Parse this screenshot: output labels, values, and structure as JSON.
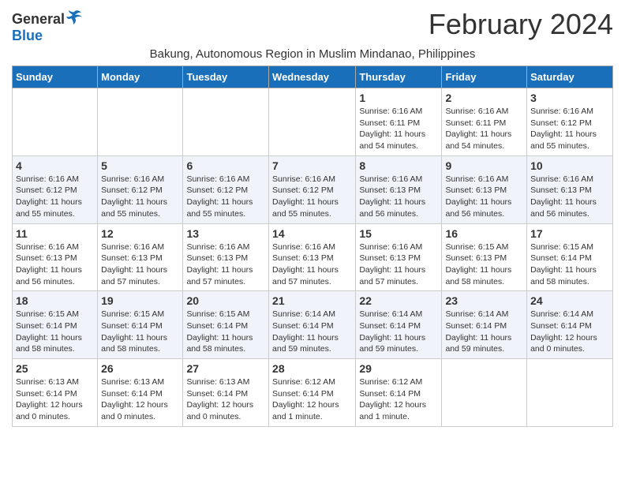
{
  "logo": {
    "general": "General",
    "blue": "Blue"
  },
  "title": "February 2024",
  "subtitle": "Bakung, Autonomous Region in Muslim Mindanao, Philippines",
  "days_of_week": [
    "Sunday",
    "Monday",
    "Tuesday",
    "Wednesday",
    "Thursday",
    "Friday",
    "Saturday"
  ],
  "weeks": [
    [
      {
        "day": "",
        "info": ""
      },
      {
        "day": "",
        "info": ""
      },
      {
        "day": "",
        "info": ""
      },
      {
        "day": "",
        "info": ""
      },
      {
        "day": "1",
        "info": "Sunrise: 6:16 AM\nSunset: 6:11 PM\nDaylight: 11 hours and 54 minutes."
      },
      {
        "day": "2",
        "info": "Sunrise: 6:16 AM\nSunset: 6:11 PM\nDaylight: 11 hours and 54 minutes."
      },
      {
        "day": "3",
        "info": "Sunrise: 6:16 AM\nSunset: 6:12 PM\nDaylight: 11 hours and 55 minutes."
      }
    ],
    [
      {
        "day": "4",
        "info": "Sunrise: 6:16 AM\nSunset: 6:12 PM\nDaylight: 11 hours and 55 minutes."
      },
      {
        "day": "5",
        "info": "Sunrise: 6:16 AM\nSunset: 6:12 PM\nDaylight: 11 hours and 55 minutes."
      },
      {
        "day": "6",
        "info": "Sunrise: 6:16 AM\nSunset: 6:12 PM\nDaylight: 11 hours and 55 minutes."
      },
      {
        "day": "7",
        "info": "Sunrise: 6:16 AM\nSunset: 6:12 PM\nDaylight: 11 hours and 55 minutes."
      },
      {
        "day": "8",
        "info": "Sunrise: 6:16 AM\nSunset: 6:13 PM\nDaylight: 11 hours and 56 minutes."
      },
      {
        "day": "9",
        "info": "Sunrise: 6:16 AM\nSunset: 6:13 PM\nDaylight: 11 hours and 56 minutes."
      },
      {
        "day": "10",
        "info": "Sunrise: 6:16 AM\nSunset: 6:13 PM\nDaylight: 11 hours and 56 minutes."
      }
    ],
    [
      {
        "day": "11",
        "info": "Sunrise: 6:16 AM\nSunset: 6:13 PM\nDaylight: 11 hours and 56 minutes."
      },
      {
        "day": "12",
        "info": "Sunrise: 6:16 AM\nSunset: 6:13 PM\nDaylight: 11 hours and 57 minutes."
      },
      {
        "day": "13",
        "info": "Sunrise: 6:16 AM\nSunset: 6:13 PM\nDaylight: 11 hours and 57 minutes."
      },
      {
        "day": "14",
        "info": "Sunrise: 6:16 AM\nSunset: 6:13 PM\nDaylight: 11 hours and 57 minutes."
      },
      {
        "day": "15",
        "info": "Sunrise: 6:16 AM\nSunset: 6:13 PM\nDaylight: 11 hours and 57 minutes."
      },
      {
        "day": "16",
        "info": "Sunrise: 6:15 AM\nSunset: 6:13 PM\nDaylight: 11 hours and 58 minutes."
      },
      {
        "day": "17",
        "info": "Sunrise: 6:15 AM\nSunset: 6:14 PM\nDaylight: 11 hours and 58 minutes."
      }
    ],
    [
      {
        "day": "18",
        "info": "Sunrise: 6:15 AM\nSunset: 6:14 PM\nDaylight: 11 hours and 58 minutes."
      },
      {
        "day": "19",
        "info": "Sunrise: 6:15 AM\nSunset: 6:14 PM\nDaylight: 11 hours and 58 minutes."
      },
      {
        "day": "20",
        "info": "Sunrise: 6:15 AM\nSunset: 6:14 PM\nDaylight: 11 hours and 58 minutes."
      },
      {
        "day": "21",
        "info": "Sunrise: 6:14 AM\nSunset: 6:14 PM\nDaylight: 11 hours and 59 minutes."
      },
      {
        "day": "22",
        "info": "Sunrise: 6:14 AM\nSunset: 6:14 PM\nDaylight: 11 hours and 59 minutes."
      },
      {
        "day": "23",
        "info": "Sunrise: 6:14 AM\nSunset: 6:14 PM\nDaylight: 11 hours and 59 minutes."
      },
      {
        "day": "24",
        "info": "Sunrise: 6:14 AM\nSunset: 6:14 PM\nDaylight: 12 hours and 0 minutes."
      }
    ],
    [
      {
        "day": "25",
        "info": "Sunrise: 6:13 AM\nSunset: 6:14 PM\nDaylight: 12 hours and 0 minutes."
      },
      {
        "day": "26",
        "info": "Sunrise: 6:13 AM\nSunset: 6:14 PM\nDaylight: 12 hours and 0 minutes."
      },
      {
        "day": "27",
        "info": "Sunrise: 6:13 AM\nSunset: 6:14 PM\nDaylight: 12 hours and 0 minutes."
      },
      {
        "day": "28",
        "info": "Sunrise: 6:12 AM\nSunset: 6:14 PM\nDaylight: 12 hours and 1 minute."
      },
      {
        "day": "29",
        "info": "Sunrise: 6:12 AM\nSunset: 6:14 PM\nDaylight: 12 hours and 1 minute."
      },
      {
        "day": "",
        "info": ""
      },
      {
        "day": "",
        "info": ""
      }
    ]
  ]
}
